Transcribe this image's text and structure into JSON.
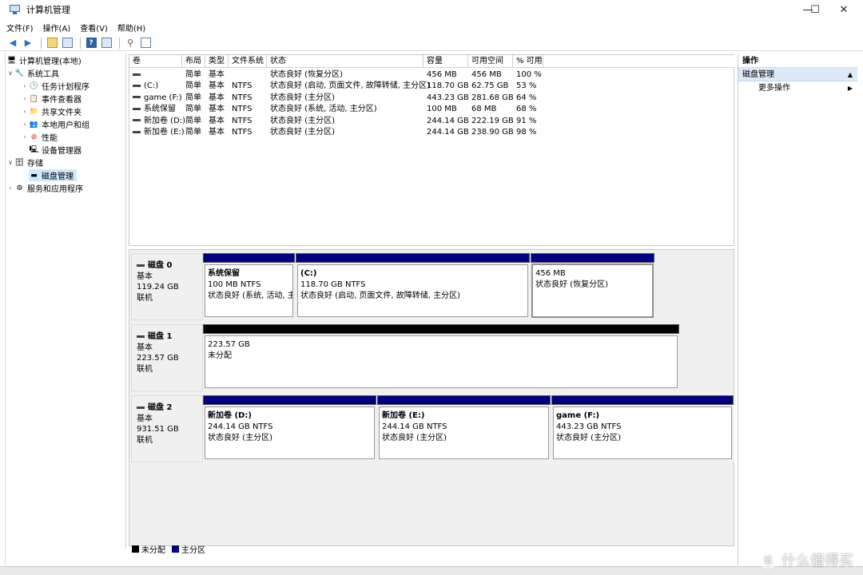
{
  "window": {
    "title": "计算机管理",
    "controls": {
      "minimize": "—",
      "maximize": "☐",
      "close": "✕"
    }
  },
  "menu": [
    "文件(F)",
    "操作(A)",
    "查看(V)",
    "帮助(H)"
  ],
  "tree": {
    "root": "计算机管理(本地)",
    "system_tools": "系统工具",
    "items": [
      "任务计划程序",
      "事件查看器",
      "共享文件夹",
      "本地用户和组",
      "性能",
      "设备管理器"
    ],
    "storage": "存储",
    "disk_mgmt": "磁盘管理",
    "services": "服务和应用程序"
  },
  "columns": [
    "卷",
    "布局",
    "类型",
    "文件系统",
    "状态",
    "容量",
    "可用空间",
    "% 可用"
  ],
  "volumes": [
    [
      "",
      "简单",
      "基本",
      "",
      "状态良好 (恢复分区)",
      "456 MB",
      "456 MB",
      "100 %"
    ],
    [
      "(C:)",
      "简单",
      "基本",
      "NTFS",
      "状态良好 (启动, 页面文件, 故障转储, 主分区)",
      "118.70 GB",
      "62.75 GB",
      "53 %"
    ],
    [
      "game (F:)",
      "简单",
      "基本",
      "NTFS",
      "状态良好 (主分区)",
      "443.23 GB",
      "281.68 GB",
      "64 %"
    ],
    [
      "系统保留",
      "简单",
      "基本",
      "NTFS",
      "状态良好 (系统, 活动, 主分区)",
      "100 MB",
      "68 MB",
      "68 %"
    ],
    [
      "新加卷 (D:)",
      "简单",
      "基本",
      "NTFS",
      "状态良好 (主分区)",
      "244.14 GB",
      "222.19 GB",
      "91 %"
    ],
    [
      "新加卷 (E:)",
      "简单",
      "基本",
      "NTFS",
      "状态良好 (主分区)",
      "244.14 GB",
      "238.90 GB",
      "98 %"
    ]
  ],
  "disks": [
    {
      "name": "磁盘 0",
      "type": "基本",
      "size": "119.24 GB",
      "state": "联机",
      "parts": [
        {
          "title": "系统保留",
          "size": "100 MB NTFS",
          "status": "状态良好 (系统, 活动, 主"
        },
        {
          "title": "(C:)",
          "size": "118.70 GB NTFS",
          "status": "状态良好 (启动, 页面文件, 故障转储, 主分区)"
        },
        {
          "title": "",
          "size": "456 MB",
          "status": "状态良好 (恢复分区)"
        }
      ]
    },
    {
      "name": "磁盘 1",
      "type": "基本",
      "size": "223.57 GB",
      "state": "联机",
      "parts": [
        {
          "title": "",
          "size": "223.57 GB",
          "status": "未分配"
        }
      ]
    },
    {
      "name": "磁盘 2",
      "type": "基本",
      "size": "931.51 GB",
      "state": "联机",
      "parts": [
        {
          "title": "新加卷 (D:)",
          "size": "244.14 GB NTFS",
          "status": "状态良好 (主分区)"
        },
        {
          "title": "新加卷 (E:)",
          "size": "244.14 GB NTFS",
          "status": "状态良好 (主分区)"
        },
        {
          "title": "game (F:)",
          "size": "443.23 GB NTFS",
          "status": "状态良好 (主分区)"
        }
      ]
    }
  ],
  "legend": {
    "unallocated": "未分配",
    "primary": "主分区",
    "unallocated_color": "#000000",
    "primary_color": "#000080"
  },
  "actions": {
    "header": "操作",
    "section": "磁盘管理",
    "more": "更多操作"
  },
  "watermark": {
    "badge": "值",
    "text": "什么值得买"
  }
}
